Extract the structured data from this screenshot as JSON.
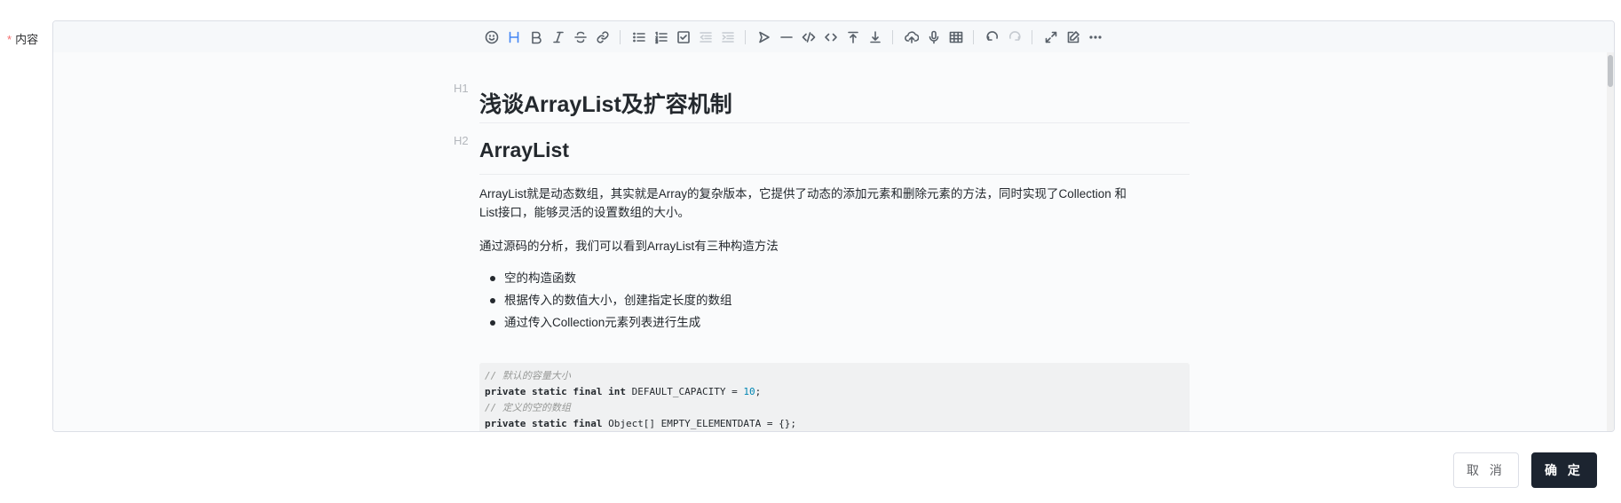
{
  "form": {
    "required_mark": "*",
    "label": "内容"
  },
  "toolbar": {
    "icons": [
      "emoji-icon",
      "headings-icon",
      "bold-icon",
      "italic-icon",
      "strike-icon",
      "link-icon",
      "list-icon",
      "ordered-list-icon",
      "check-icon",
      "outdent-icon",
      "indent-icon",
      "quote-icon",
      "line-icon",
      "code-icon",
      "inline-code-icon",
      "insert-before-icon",
      "insert-after-icon",
      "upload-icon",
      "record-icon",
      "table-icon",
      "undo-icon",
      "redo-icon",
      "fullscreen-icon",
      "edit-mode-icon",
      "more-icon"
    ]
  },
  "doc": {
    "h1_mark": "H1",
    "h1": "浅谈ArrayList及扩容机制",
    "h2_mark": "H2",
    "h2": "ArrayList",
    "p1_line1": "ArrayList就是动态数组，其实就是Array的复杂版本，它提供了动态的添加元素和删除元素的方法，同时实现了Collection 和",
    "p1_line2": "List接口，能够灵活的设置数组的大小。",
    "p2": "通过源码的分析，我们可以看到ArrayList有三种构造方法",
    "bullets": [
      "空的构造函数",
      "根据传入的数值大小，创建指定长度的数组",
      "通过传入Collection元素列表进行生成"
    ],
    "code": {
      "c1": "// 默认的容量大小",
      "l2_kw": "private static final int",
      "l2_rest": " DEFAULT_CAPACITY = ",
      "l2_num": "10",
      "l2_end": ";",
      "c3": "// 定义的空的数组",
      "l4_kw": "private static final",
      "l4_rest": " Object[] EMPTY_ELEMENTDATA = {};"
    }
  },
  "actions": {
    "cancel": "取 消",
    "ok": "确 定"
  },
  "colors": {
    "active_icon": "#4285f4",
    "primary_button": "#1c2430",
    "required": "#f56c6c"
  }
}
